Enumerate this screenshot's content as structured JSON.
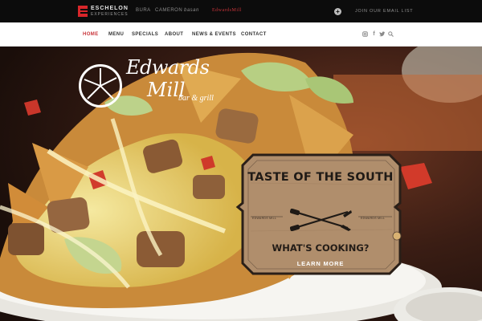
{
  "topbar": {
    "company_name": "ESCHELON",
    "company_sub": "EXPERIENCES",
    "brands": [
      "BURA",
      "CAMERON",
      "basan",
      "EdwardsMill"
    ],
    "email_link": "JOIN OUR EMAIL LIST",
    "plus_icon": "plus-circle-icon"
  },
  "nav": {
    "items": [
      "HOME",
      "MENU",
      "SPECIALS",
      "ABOUT",
      "NEWS & EVENTS",
      "CONTACT"
    ],
    "active_index": 0,
    "social_icons": [
      "instagram-icon",
      "facebook-icon",
      "twitter-icon",
      "search-icon"
    ]
  },
  "restaurant": {
    "name_line1": "Edwards",
    "name_line2": "Mill",
    "tagline": "bar & grill"
  },
  "promo": {
    "title": "TASTE OF THE SOUTH",
    "small_left": "EDWARDS MILL",
    "small_right": "EDWARDS MILL",
    "cta": "WHAT'S COOKING?",
    "link": "LEARN MORE"
  },
  "colors": {
    "accent": "#c8343a",
    "topbar": "#0c0c0c",
    "sign_wood": "#b08e6c"
  }
}
